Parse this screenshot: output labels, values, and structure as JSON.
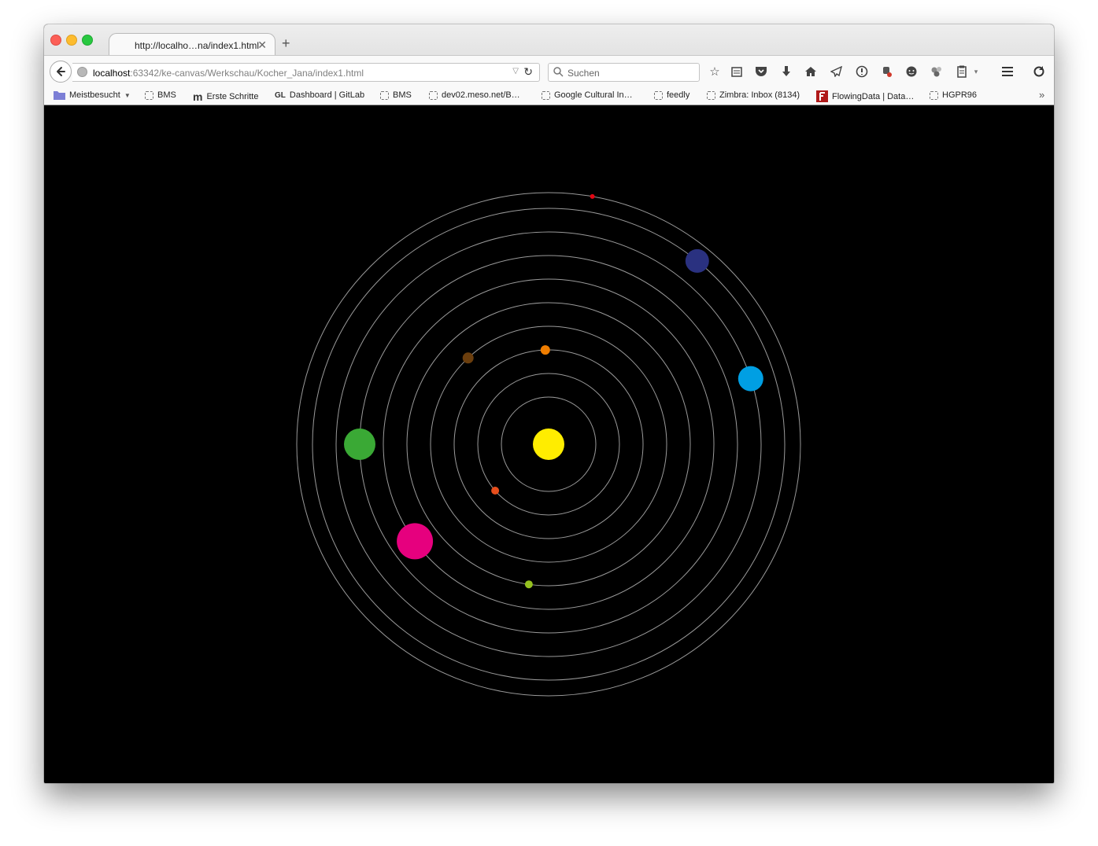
{
  "browser": {
    "tab_title": "http://localho…na/index1.html",
    "url_host": "localhost",
    "url_path": ":63342/ke-canvas/Werkschau/Kocher_Jana/index1.html",
    "search_placeholder": "Suchen"
  },
  "bookmarks": [
    {
      "label": "Meistbesucht",
      "icon": "folder-icon"
    },
    {
      "label": "BMS",
      "icon": "page-icon"
    },
    {
      "label": "Erste Schritte",
      "icon": "m-logo-icon"
    },
    {
      "label": "Dashboard | GitLab",
      "icon": "gitlab-icon"
    },
    {
      "label": "BMS",
      "icon": "page-icon"
    },
    {
      "label": "dev02.meso.net/B…",
      "icon": "page-icon"
    },
    {
      "label": "Google Cultural In…",
      "icon": "page-icon"
    },
    {
      "label": "feedly",
      "icon": "page-icon"
    },
    {
      "label": "Zimbra: Inbox (8134)",
      "icon": "page-icon"
    },
    {
      "label": "FlowingData | Data…",
      "icon": "flowingdata-icon"
    },
    {
      "label": "HGPR96",
      "icon": "page-icon"
    }
  ],
  "solar_system": {
    "background": "#000000",
    "sun_color": "#ffed00",
    "orbit_color": "#9a9a9a",
    "planets": [
      {
        "name": "planet-1",
        "color": "#e74e1c",
        "angle_deg": 139
      },
      {
        "name": "planet-2",
        "color": "#ef7d00",
        "angle_deg": 268
      },
      {
        "name": "planet-3",
        "color": "#6b3e0d",
        "angle_deg": 227
      },
      {
        "name": "planet-4",
        "color": "#95c11f",
        "angle_deg": 98
      },
      {
        "name": "planet-5",
        "color": "#e6007e",
        "angle_deg": 144
      },
      {
        "name": "planet-6",
        "color": "#3aa935",
        "angle_deg": 180
      },
      {
        "name": "planet-7",
        "color": "#009fe3",
        "angle_deg": 342
      },
      {
        "name": "planet-8",
        "color": "#2a3180",
        "angle_deg": 309
      },
      {
        "name": "planet-9",
        "color": "#e30613",
        "angle_deg": 280
      }
    ]
  }
}
